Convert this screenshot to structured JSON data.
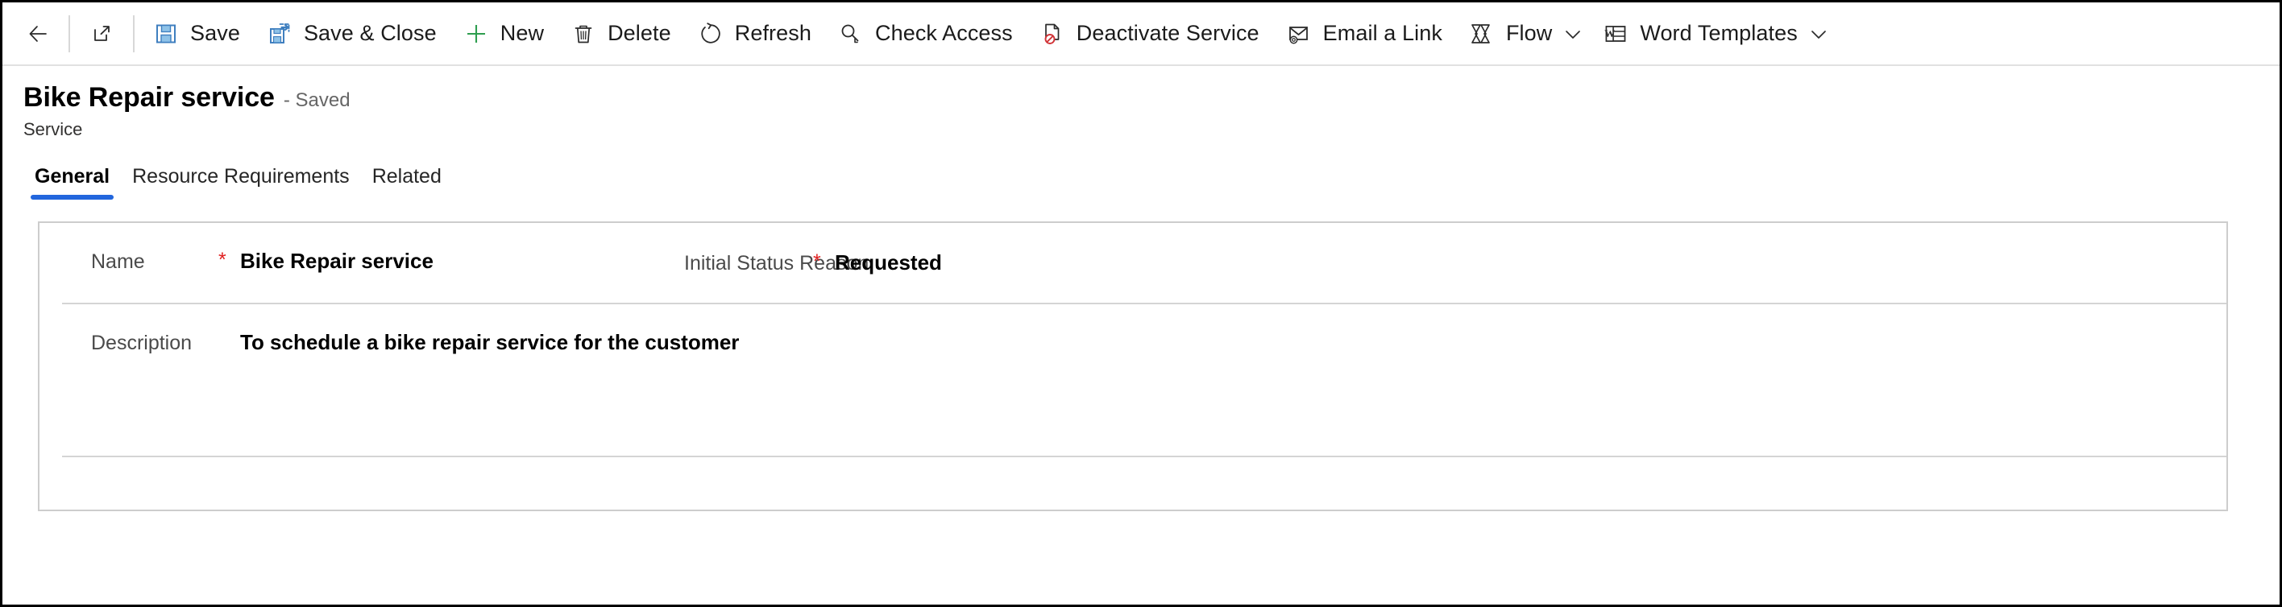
{
  "commandbar": {
    "items": [
      {
        "name": "back",
        "icon": "back-arrow-icon",
        "label": ""
      },
      {
        "name": "popout",
        "icon": "popout-icon",
        "label": ""
      },
      {
        "name": "save",
        "icon": "save-icon",
        "label": "Save"
      },
      {
        "name": "save-and-close",
        "icon": "save-and-close-icon",
        "label": "Save & Close"
      },
      {
        "name": "new",
        "icon": "plus-icon",
        "label": "New"
      },
      {
        "name": "delete",
        "icon": "trash-icon",
        "label": "Delete"
      },
      {
        "name": "refresh",
        "icon": "refresh-icon",
        "label": "Refresh"
      },
      {
        "name": "check-access",
        "icon": "check-access-key-icon",
        "label": "Check Access"
      },
      {
        "name": "deactivate-service",
        "icon": "deactivate-icon",
        "label": "Deactivate Service"
      },
      {
        "name": "email-a-link",
        "icon": "email-link-icon",
        "label": "Email a Link"
      },
      {
        "name": "flow",
        "icon": "flow-icon",
        "label": "Flow"
      },
      {
        "name": "word-templates",
        "icon": "word-template-icon",
        "label": "Word Templates"
      }
    ],
    "overflow_caret": "chevron-down-icon"
  },
  "header": {
    "title": "Bike Repair service",
    "saved_status": "- Saved",
    "entity": "Service"
  },
  "tabs": [
    {
      "label": "General",
      "active": true
    },
    {
      "label": "Resource Requirements",
      "active": false
    },
    {
      "label": "Related",
      "active": false
    }
  ],
  "form": {
    "name": {
      "label": "Name",
      "required_marker": "*",
      "value": "Bike Repair service"
    },
    "initial_status_reason": {
      "label": "Initial Status Reason",
      "required_marker": "*",
      "value": "Requested"
    },
    "description": {
      "label": "Description",
      "value": "To schedule a bike repair service for the customer"
    }
  },
  "colors": {
    "accent": "#2266dd",
    "required": "#e02020",
    "save_icon": "#3f7fbf",
    "new_icon": "#2e9e4f",
    "deactivate_icon": "#d13438",
    "word_icon": "#2b579a",
    "border": "#cdcdcd",
    "divider": "#d4d4d4"
  }
}
